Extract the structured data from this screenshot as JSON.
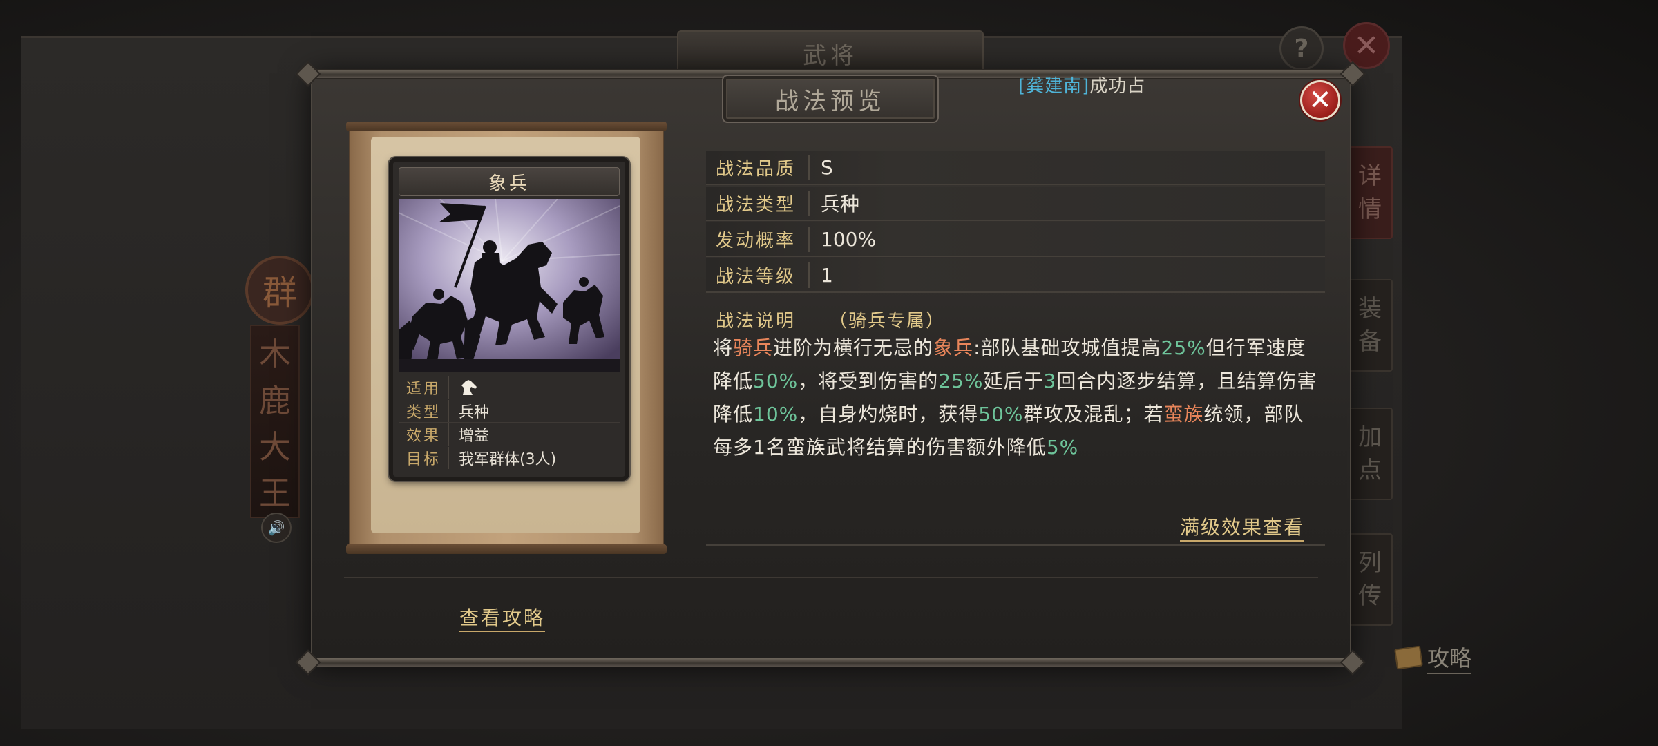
{
  "background": {
    "title": "武将",
    "help_label": "?",
    "close_label": "✕",
    "seal_char": "群",
    "general_name_chars": [
      "木",
      "鹿",
      "大",
      "王"
    ],
    "tabs": [
      {
        "label": "详\n情",
        "active": true
      },
      {
        "label": "装\n备",
        "active": false
      },
      {
        "label": "加\n点",
        "active": false
      },
      {
        "label": "列\n传",
        "active": false
      }
    ],
    "guide_label": "攻略",
    "announcement": {
      "player": "[龚建南]",
      "text": "成功占"
    }
  },
  "dialog": {
    "title": "战法预览",
    "close_label": "✕",
    "card": {
      "name": "象兵",
      "info": [
        {
          "label": "适用",
          "value": "",
          "icon": "horse-icon"
        },
        {
          "label": "类型",
          "value": "兵种"
        },
        {
          "label": "效果",
          "value": "增益"
        },
        {
          "label": "目标",
          "value": "我军群体(3人)"
        }
      ]
    },
    "attributes": [
      {
        "label": "战法品质",
        "value": "S"
      },
      {
        "label": "战法类型",
        "value": "兵种"
      },
      {
        "label": "发动概率",
        "value": "100%"
      },
      {
        "label": "战法等级",
        "value": "1"
      }
    ],
    "description": {
      "header": "战法说明",
      "exclusive": "（骑兵专属）",
      "segments": [
        {
          "text": "将",
          "color": "normal"
        },
        {
          "text": "骑兵",
          "color": "orange"
        },
        {
          "text": "进阶为横行无忌的",
          "color": "normal"
        },
        {
          "text": "象兵",
          "color": "orange"
        },
        {
          "text": ":部队基础攻城值提高",
          "color": "normal"
        },
        {
          "text": "25%",
          "color": "green"
        },
        {
          "text": "但行军速度降低",
          "color": "normal"
        },
        {
          "text": "50%",
          "color": "green"
        },
        {
          "text": "，将受到伤害的",
          "color": "normal"
        },
        {
          "text": "25%",
          "color": "green"
        },
        {
          "text": "延后于",
          "color": "normal"
        },
        {
          "text": "3",
          "color": "green"
        },
        {
          "text": "回合内逐步结算，且结算伤害降低",
          "color": "normal"
        },
        {
          "text": "10%",
          "color": "green"
        },
        {
          "text": "，自身灼烧时，获得",
          "color": "normal"
        },
        {
          "text": "50%",
          "color": "green"
        },
        {
          "text": "群攻及混乱；若",
          "color": "normal"
        },
        {
          "text": "蛮族",
          "color": "orange"
        },
        {
          "text": "统领，部队每多1名蛮族武将结算的伤害额外降低",
          "color": "normal"
        },
        {
          "text": "5%",
          "color": "green"
        }
      ]
    },
    "max_level_link": "满级效果查看",
    "guide_link": "查看攻略"
  },
  "colors": {
    "gold_label": "#e2c98a",
    "highlight_orange": "#e8855a",
    "highlight_green": "#6ec49a",
    "close_red": "#b8302a",
    "player_blue": "#4fb4d8"
  }
}
